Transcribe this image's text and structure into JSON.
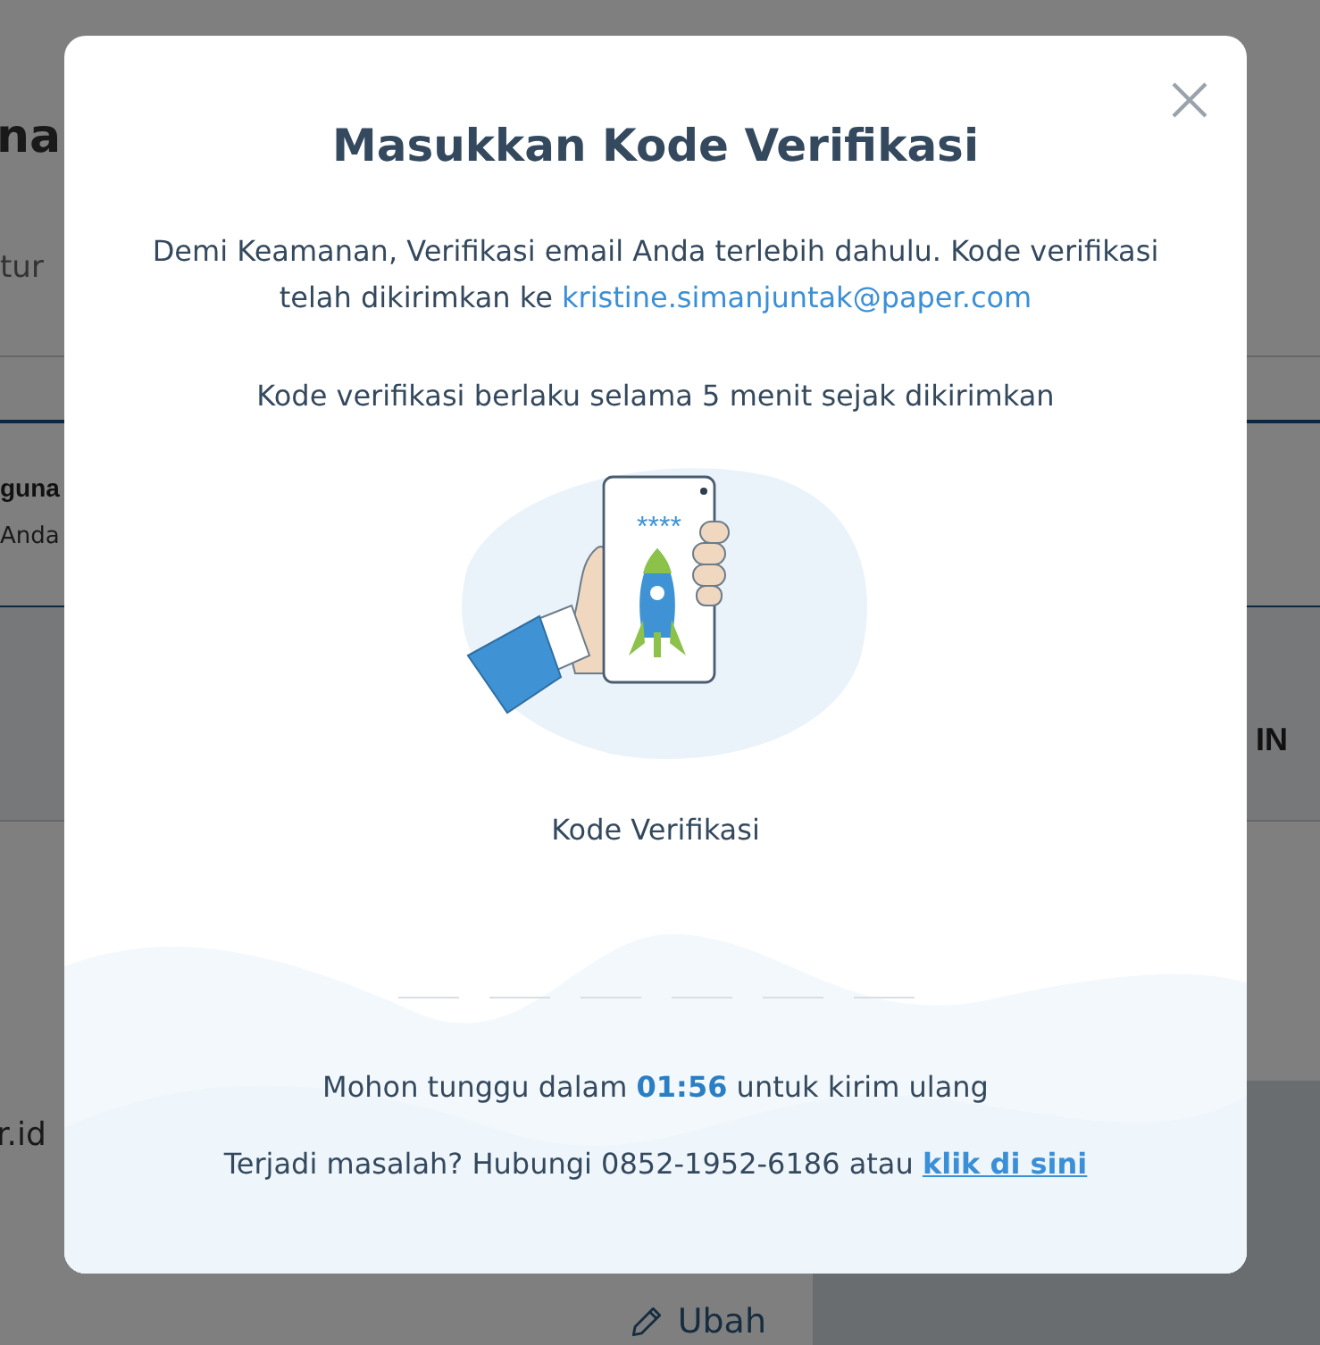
{
  "background": {
    "heading": "na",
    "tab_label": "tur",
    "section_title": "guna",
    "section_note": "Anda",
    "side_label": "IN",
    "email_tail": "r.id",
    "edit_button": "Ubah"
  },
  "dialog": {
    "title": "Masukkan Kode Verifikasi",
    "intro": "Demi Keamanan, Verifikasi email Anda terlebih dahulu. Kode verifikasi telah dikirimkan ke",
    "email": "kristine.simanjuntak@paper.com",
    "validity": "Kode verifikasi berlaku selama 5 menit sejak dikirimkan",
    "screen_mask": "****",
    "code_label": "Kode Verifikasi",
    "wait_before": "Mohon tunggu dalam",
    "countdown": "01:56",
    "wait_after": "untuk kirim ulang",
    "help_text": "Terjadi masalah? Hubungi 0852-1952-6186 atau",
    "help_link": "klik di sini"
  }
}
